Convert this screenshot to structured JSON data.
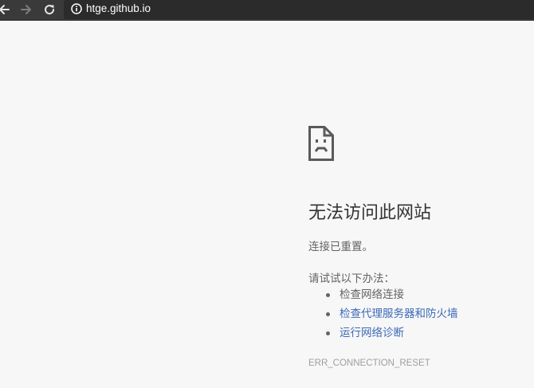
{
  "browser": {
    "url": "htge.github.io",
    "icons": {
      "back": "arrow-left-icon",
      "forward": "arrow-right-icon",
      "reload": "reload-icon",
      "site_info": "info-circle-icon"
    }
  },
  "error_page": {
    "icon": "sad-document-icon",
    "title": "无法访问此网站",
    "summary": "连接已重置。",
    "suggest_intro": "请试试以下办法：",
    "suggestions": [
      {
        "label": "检查网络连接",
        "link": false
      },
      {
        "label": "检查代理服务器和防火墙",
        "link": true
      },
      {
        "label": "运行网络诊断",
        "link": true
      }
    ],
    "error_code": "ERR_CONNECTION_RESET"
  },
  "colors": {
    "toolbar_bg": "#3a3a3a",
    "page_bg": "#f7f7f7",
    "link": "#3c6ab6",
    "text": "#646464",
    "title": "#333333"
  }
}
